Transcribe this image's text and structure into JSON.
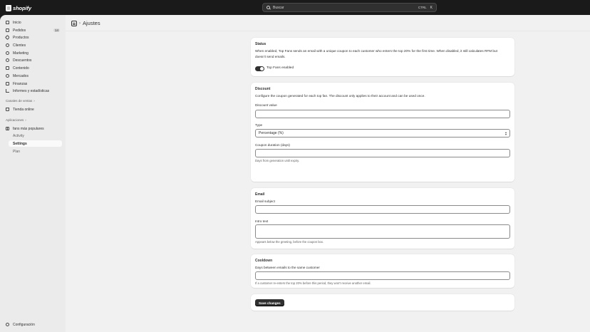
{
  "topbar": {
    "brand": "shopify",
    "search_placeholder": "Buscar",
    "shortcut": "CTRL",
    "shortcut_key": "K"
  },
  "sidebar": {
    "items": [
      {
        "label": "Inicio",
        "icon": "home-icon"
      },
      {
        "label": "Pedidos",
        "icon": "orders-icon",
        "badge": "14"
      },
      {
        "label": "Productos",
        "icon": "tag-icon"
      },
      {
        "label": "Clientes",
        "icon": "person-icon"
      },
      {
        "label": "Marketing",
        "icon": "target-icon"
      },
      {
        "label": "Descuentos",
        "icon": "discount-icon"
      },
      {
        "label": "Contenido",
        "icon": "content-icon"
      },
      {
        "label": "Mercados",
        "icon": "globe-icon"
      },
      {
        "label": "Finanzas",
        "icon": "bank-icon"
      },
      {
        "label": "Informes y estadísticas",
        "icon": "chart-icon"
      }
    ],
    "sales_channels_label": "Canales de ventas",
    "online_store": "Tienda online",
    "apps_label": "Aplicaciones",
    "app_name": "fans más populares",
    "app_subitems": [
      "Activity",
      "Settings",
      "Plan"
    ],
    "settings_label": "Configuración"
  },
  "header": {
    "title": "Ajustes"
  },
  "status_card": {
    "title": "Status",
    "description": "When enabled, Top Fans sends an email with a unique coupon to each customer who enters the top 20% for the first time. When disabled, it still calculates RFM but doesn't send emails.",
    "toggle_label": "Top Fans enabled"
  },
  "discount_card": {
    "title": "Discount",
    "description": "Configure the coupon generated for each top fan. The discount only applies to their account and can be used once.",
    "value_label": "Discount value",
    "type_label": "Type",
    "type_selected": "Percentage (%)",
    "duration_label": "Coupon duration (days)",
    "duration_help": "Days from generation until expiry."
  },
  "email_card": {
    "title": "Email",
    "subject_label": "Email subject",
    "intro_label": "Intro text",
    "intro_help": "Appears below the greeting, before the coupon box."
  },
  "cooldown_card": {
    "title": "Cooldown",
    "days_label": "Days between emails to the same customer",
    "days_help": "If a customer re-enters the top 20% before this period, they won't receive another email."
  },
  "actions": {
    "save_label": "Save changes"
  },
  "colors": {
    "topbar": "#1a1a1a",
    "sidebar": "#ebebeb",
    "main_bg": "#f1f1f1",
    "primary_button": "#303030"
  }
}
